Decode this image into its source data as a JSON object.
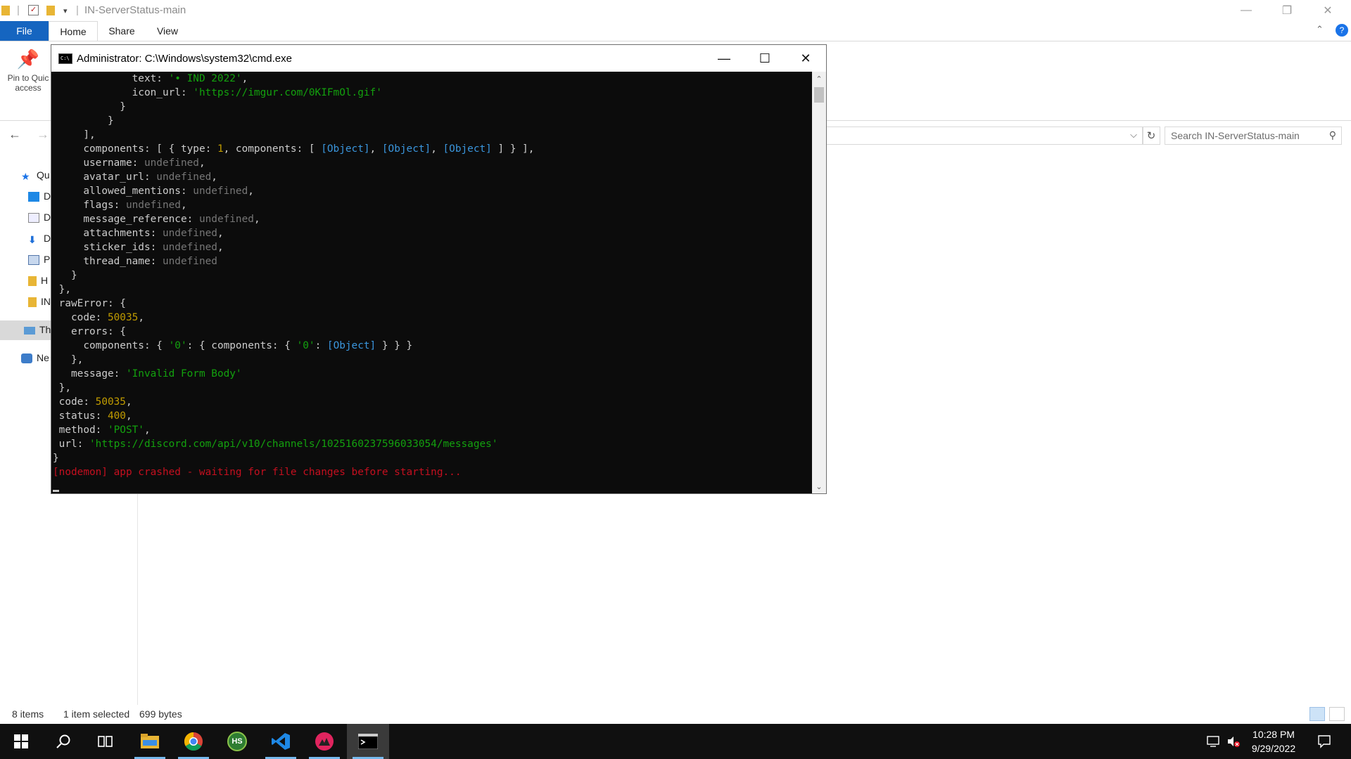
{
  "explorer": {
    "title": "IN-ServerStatus-main",
    "tabs": {
      "file": "File",
      "home": "Home",
      "share": "Share",
      "view": "View"
    },
    "ribbon": {
      "pin_label_1": "Pin to Quic",
      "pin_label_2": "access"
    },
    "search_placeholder": "Search IN-ServerStatus-main",
    "nav_items": [
      "Qu",
      "D",
      "D",
      "D",
      "P",
      "H",
      "IN",
      "Th",
      "Ne"
    ],
    "status": {
      "items": "8 items",
      "selected": "1 item selected",
      "size": "699 bytes"
    }
  },
  "cmd": {
    "title": "Administrator:  C:\\Windows\\system32\\cmd.exe",
    "lines": [
      [
        [
          "        text: ",
          "t"
        ],
        [
          "'• IND 2022'",
          "s"
        ],
        [
          ",",
          "t"
        ]
      ],
      [
        [
          "        icon_url: ",
          "t"
        ],
        [
          "'https://imgur.com/0KIFmOl.gif'",
          "s"
        ]
      ],
      [
        [
          "      }",
          "t"
        ]
      ],
      [
        [
          "    }",
          "t"
        ]
      ],
      [
        [
          "  ],",
          "t"
        ]
      ],
      [
        [
          "  components: [ { type: ",
          "t"
        ],
        [
          "1",
          "n"
        ],
        [
          ", components: [ ",
          "t"
        ],
        [
          "[Object]",
          "o"
        ],
        [
          ", ",
          "t"
        ],
        [
          "[Object]",
          "o"
        ],
        [
          ", ",
          "t"
        ],
        [
          "[Object]",
          "o"
        ],
        [
          " ] } ],",
          "t"
        ]
      ],
      [
        [
          "  username: ",
          "t"
        ],
        [
          "undefined",
          "u"
        ],
        [
          ",",
          "t"
        ]
      ],
      [
        [
          "  avatar_url: ",
          "t"
        ],
        [
          "undefined",
          "u"
        ],
        [
          ",",
          "t"
        ]
      ],
      [
        [
          "  allowed_mentions: ",
          "t"
        ],
        [
          "undefined",
          "u"
        ],
        [
          ",",
          "t"
        ]
      ],
      [
        [
          "  flags: ",
          "t"
        ],
        [
          "undefined",
          "u"
        ],
        [
          ",",
          "t"
        ]
      ],
      [
        [
          "  message_reference: ",
          "t"
        ],
        [
          "undefined",
          "u"
        ],
        [
          ",",
          "t"
        ]
      ],
      [
        [
          "  attachments: ",
          "t"
        ],
        [
          "undefined",
          "u"
        ],
        [
          ",",
          "t"
        ]
      ],
      [
        [
          "  sticker_ids: ",
          "t"
        ],
        [
          "undefined",
          "u"
        ],
        [
          ",",
          "t"
        ]
      ],
      [
        [
          "  thread_name: ",
          "t"
        ],
        [
          "undefined",
          "u"
        ]
      ],
      [
        [
          "  }",
          "t"
        ]
      ],
      [
        [
          "},",
          "t"
        ]
      ],
      [
        [
          "rawError: {",
          "t"
        ]
      ],
      [
        [
          "  code: ",
          "t"
        ],
        [
          "50035",
          "n"
        ],
        [
          ",",
          "t"
        ]
      ],
      [
        [
          "  errors: {",
          "t"
        ]
      ],
      [
        [
          "    components: { ",
          "t"
        ],
        [
          "'0'",
          "s"
        ],
        [
          ": { components: { ",
          "t"
        ],
        [
          "'0'",
          "s"
        ],
        [
          ": ",
          "t"
        ],
        [
          "[Object]",
          "o"
        ],
        [
          " } } }",
          "t"
        ]
      ],
      [
        [
          "  },",
          "t"
        ]
      ],
      [
        [
          "  message: ",
          "t"
        ],
        [
          "'Invalid Form Body'",
          "s"
        ]
      ],
      [
        [
          "},",
          "t"
        ]
      ],
      [
        [
          "code: ",
          "t"
        ],
        [
          "50035",
          "n"
        ],
        [
          ",",
          "t"
        ]
      ],
      [
        [
          "status: ",
          "t"
        ],
        [
          "400",
          "n"
        ],
        [
          ",",
          "t"
        ]
      ],
      [
        [
          "method: ",
          "t"
        ],
        [
          "'POST'",
          "s"
        ],
        [
          ",",
          "t"
        ]
      ],
      [
        [
          "url: ",
          "t"
        ],
        [
          "'https://discord.com/api/v10/channels/1025160237596033054/messages'",
          "s"
        ]
      ],
      [
        [
          "}",
          "t"
        ]
      ],
      [
        [
          "[nodemon] app crashed - waiting for file changes before starting...",
          "r"
        ]
      ]
    ],
    "indent": [
      5,
      5,
      5,
      5,
      3,
      3,
      3,
      3,
      3,
      3,
      3,
      3,
      3,
      3,
      1,
      1,
      1,
      1,
      1,
      1,
      1,
      1,
      1,
      1,
      1,
      1,
      1,
      0,
      0
    ]
  },
  "taskbar": {
    "clock_time": "10:28 PM",
    "clock_date": "9/29/2022",
    "apps": [
      "start-icon",
      "search-icon",
      "task-view-icon",
      "file-explorer-icon",
      "chrome-icon",
      "hs-app-icon",
      "vscode-icon",
      "app-icon",
      "cmd-icon"
    ],
    "hs_label": "HS"
  },
  "colors": {
    "console_bg": "#0c0c0c",
    "string": "#13a10e",
    "number": "#c19c00",
    "undefined": "#767676",
    "object": "#3a96dd",
    "error": "#c50f1f",
    "file_tab": "#1565c0"
  }
}
